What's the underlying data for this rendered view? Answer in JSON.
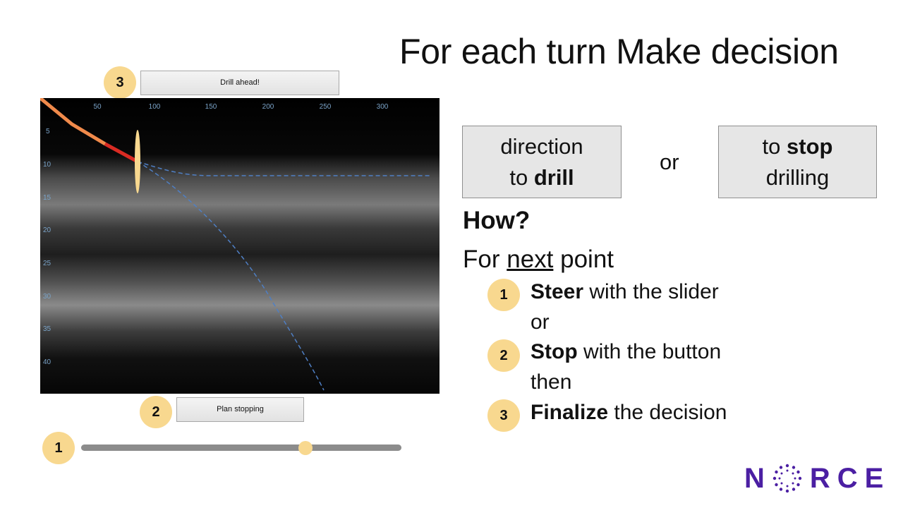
{
  "title": {
    "plain": "For each turn ",
    "bold": "Make decision"
  },
  "buttons": {
    "drill_ahead": "Drill ahead!",
    "plan_stopping": "Plan stopping"
  },
  "badges": {
    "one": "1",
    "two": "2",
    "three": "3"
  },
  "plot": {
    "x_ticks": [
      "50",
      "100",
      "150",
      "200",
      "250",
      "300"
    ],
    "y_ticks": [
      "5",
      "10",
      "15",
      "20",
      "25",
      "30",
      "35",
      "40"
    ]
  },
  "slider": {
    "value": 0.7
  },
  "options": {
    "direction_line1": "direction",
    "direction_line2_plain": "to ",
    "direction_line2_bold": "drill",
    "or": "or",
    "stop_line1_plain": "to ",
    "stop_line1_bold": "stop",
    "stop_line2": "drilling"
  },
  "instructions": {
    "how": "How?",
    "for_plain": "For ",
    "for_underlined": "next",
    "for_tail": " point",
    "steps": [
      {
        "num": "1",
        "bold": "Steer",
        "rest": " with the slider",
        "after": "or"
      },
      {
        "num": "2",
        "bold": "Stop",
        "rest": " with the button",
        "after": "then"
      },
      {
        "num": "3",
        "bold": "Finalize",
        "rest": " the decision"
      }
    ]
  },
  "logo": {
    "left": "N",
    "right": "RCE"
  },
  "colors": {
    "accent": "#f8d88f",
    "brand": "#4b1fa3",
    "trajectory": "#e2382b",
    "proposal": "#5b8fd6"
  }
}
